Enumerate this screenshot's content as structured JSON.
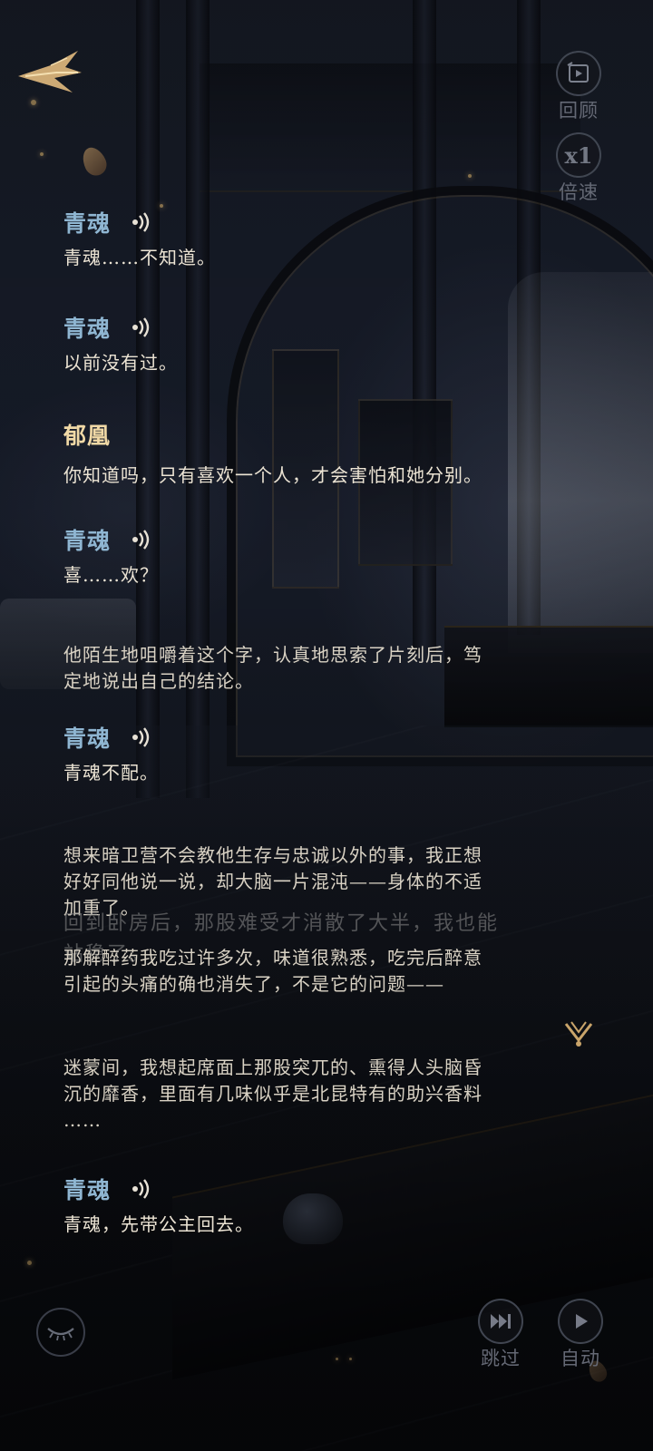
{
  "hud": {
    "review_label": "回顾",
    "speed_value": "x1",
    "speed_label": "倍速",
    "skip_label": "跳过",
    "auto_label": "自动"
  },
  "dialogue": [
    {
      "speaker": "青魂",
      "text": "青魂……不知道。",
      "speaker_color": "blue",
      "has_voice": true
    },
    {
      "speaker": "青魂",
      "text": "以前没有过。",
      "speaker_color": "blue",
      "has_voice": true
    },
    {
      "speaker": "郁凰",
      "text": "你知道吗，只有喜欢一个人，才会害怕和她分别。",
      "speaker_color": "gold",
      "has_voice": false
    },
    {
      "speaker": "青魂",
      "text": "喜……欢？",
      "speaker_color": "blue",
      "has_voice": true
    },
    {
      "speaker": "",
      "narration": [
        "他陌生地咀嚼着这个字，认真地思索了片刻后，笃",
        "定地说出自己的结论。"
      ]
    },
    {
      "speaker": "青魂",
      "text": "青魂不配。",
      "speaker_color": "blue",
      "has_voice": true
    },
    {
      "speaker": "",
      "narration": [
        "想来暗卫营不会教他生存与忠诚以外的事，我正想",
        "好好同他说一说，却大脑一片混沌——身体的不适",
        "加重了。"
      ]
    },
    {
      "speaker": "",
      "ghost": [
        "回到卧房后，那股难受才消散了大半，我也能",
        "站稳了。"
      ]
    },
    {
      "speaker": "",
      "narration": [
        "那解醉药我吃过许多次，味道很熟悉，吃完后醉意",
        "引起的头痛的确也消失了，不是它的问题——"
      ]
    },
    {
      "speaker": "",
      "narration": [
        "迷蒙间，我想起席面上那股突兀的、熏得人头脑昏",
        "沉的靡香，里面有几味似乎是北昆特有的助兴香料",
        "……"
      ]
    },
    {
      "speaker": "青魂",
      "text": "青魂，先带公主回去。",
      "speaker_color": "blue",
      "has_voice": true
    }
  ],
  "icons": {
    "back": "back-arrow-icon",
    "review": "review-icon",
    "voice": "voice-icon",
    "scroll": "scroll-down-icon",
    "hide_ui": "closed-eye-icon",
    "skip": "skip-icon",
    "auto": "auto-play-icon"
  },
  "colors": {
    "speaker_blue": "#8fb6d2",
    "speaker_gold": "#f1d9a6",
    "accent_gold": "#d7b27a"
  }
}
